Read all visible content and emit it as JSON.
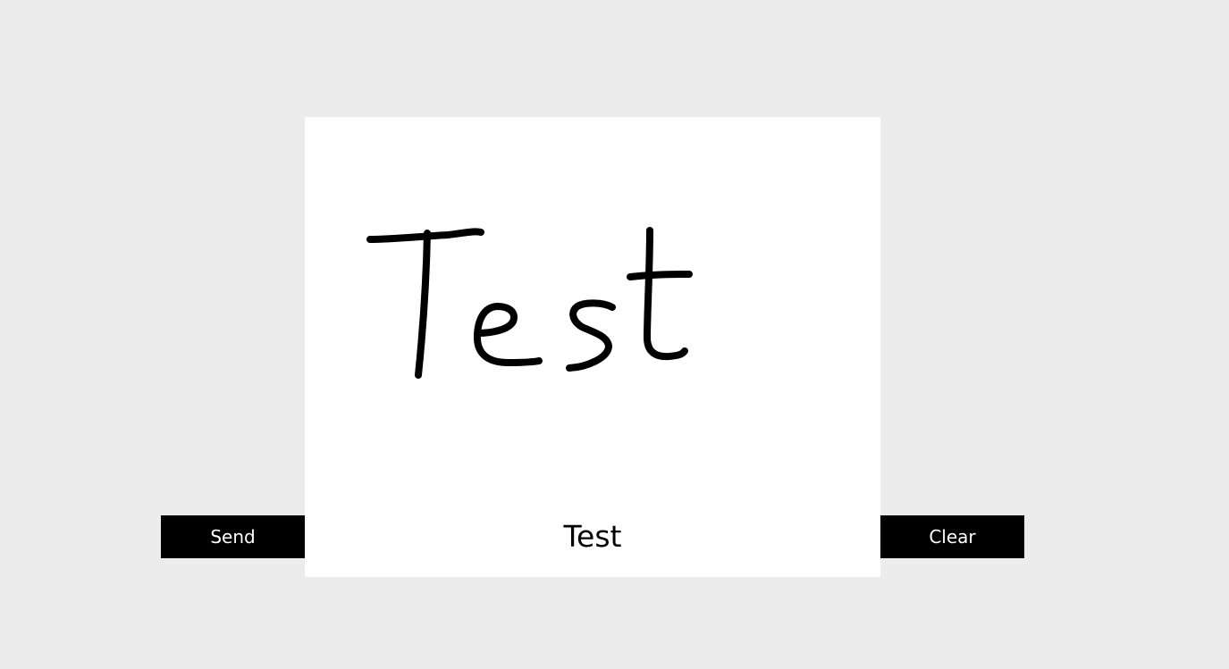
{
  "buttons": {
    "send_label": "Send",
    "clear_label": "Clear"
  },
  "pad": {
    "caption": "Test",
    "ink_color": "#000000",
    "background_color": "#ffffff"
  },
  "colors": {
    "page_background": "#ececec",
    "button_background": "#000000",
    "button_text": "#ffffff"
  }
}
